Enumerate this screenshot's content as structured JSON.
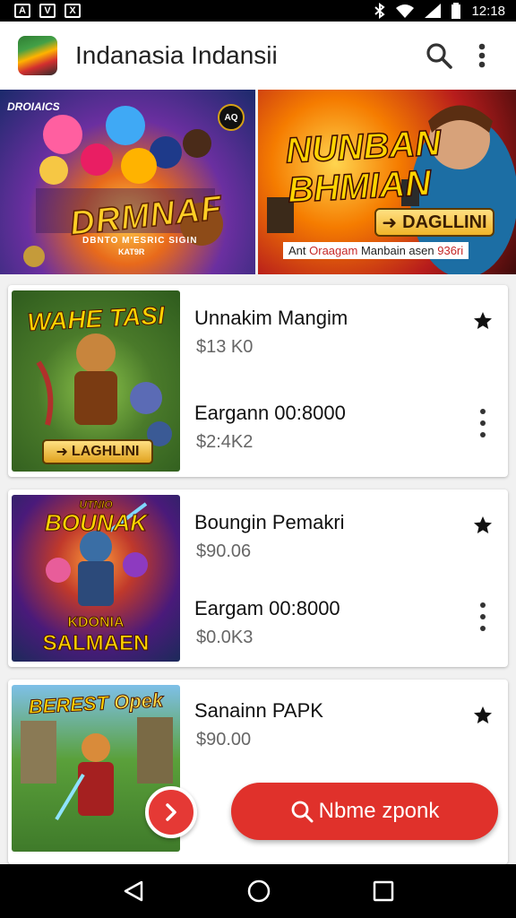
{
  "status_bar": {
    "time": "12:18",
    "notif_icons": [
      "A",
      "V",
      "X"
    ]
  },
  "app_bar": {
    "title": "Indanasia Indansii",
    "icons": [
      "app-logo",
      "search-icon",
      "more-vert-icon"
    ]
  },
  "banners": {
    "left": {
      "brand": "DROIAICS",
      "badge": "AQ",
      "title": "DRMNAF",
      "subtitle": "DBNTO M'ESRIC SIGIN",
      "subtitle2": "KAT9R"
    },
    "right": {
      "title_line1": "NUNBAN",
      "title_line2": "BHMIAN",
      "cta_label": "DAGLLINI",
      "caption_prefix": "Ant ",
      "caption_highlight": "Oraagam",
      "caption_rest": " Manbain asen ",
      "caption_number": "936ri"
    }
  },
  "cards": [
    {
      "thumb_title": "WAHE TASI",
      "thumb_cta": "LAGHLINI",
      "line1": "Unnakim Mangim",
      "price1": "$13 K0",
      "line2": "Eargann 00:8000",
      "price2": "$2:4K2"
    },
    {
      "thumb_title": "BOUNAK",
      "thumb_top": "UTNIO",
      "thumb_bottom1": "KDONIA",
      "thumb_bottom2": "SALMAEN",
      "line1": "Boungin Pemakri",
      "price1": "$90.06",
      "line2": "Eargam 00:8000",
      "price2": "$0.0K3"
    },
    {
      "thumb_title1": "BEREST",
      "thumb_title2": "Opek",
      "line1": "Sanainn PAPK",
      "price1": "$90.00"
    }
  ],
  "search_fab": {
    "label": "Nbme zponk"
  },
  "colors": {
    "accent": "#e0312b",
    "status_bar": "#000000",
    "card_bg": "#ffffff",
    "page_bg": "#f1f1f1"
  }
}
